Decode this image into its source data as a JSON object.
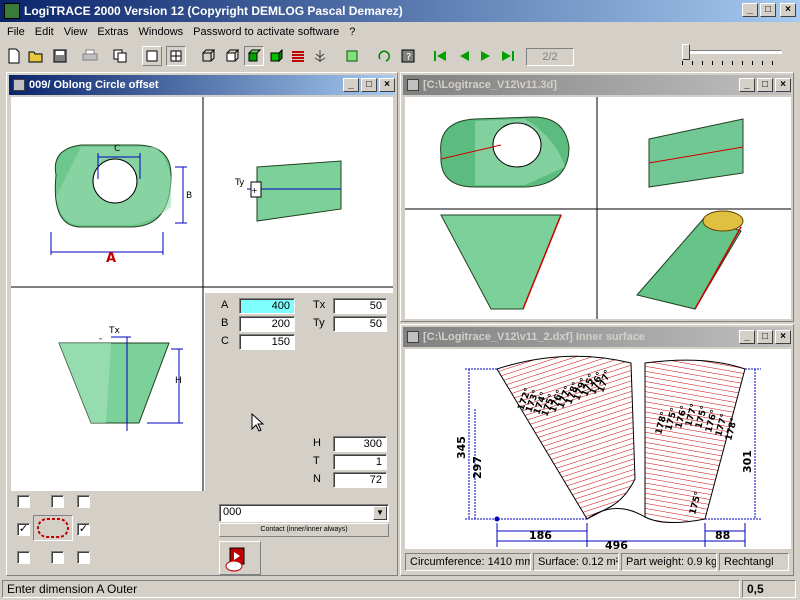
{
  "app": {
    "title": "LogiTRACE 2000  Version 12  (Copyright DEMLOG Pascal Demarez)"
  },
  "menu": [
    "File",
    "Edit",
    "View",
    "Extras",
    "Windows",
    "Password to activate software",
    "?"
  ],
  "toolbar": {
    "page_indicator": "2/2"
  },
  "window_left": {
    "title": "009/ Oblong Circle offset",
    "views": {
      "top_labels": {
        "c": "C",
        "b": "B",
        "a": "A"
      },
      "side_labels": {
        "ty": "Ty"
      },
      "front_labels": {
        "tx": "Tx",
        "h": "H",
        "minus": "-"
      }
    },
    "params": {
      "A": {
        "label": "A",
        "value": "400"
      },
      "B": {
        "label": "B",
        "value": "200"
      },
      "C": {
        "label": "C",
        "value": "150"
      },
      "Tx": {
        "label": "Tx",
        "value": "50"
      },
      "Ty": {
        "label": "Ty",
        "value": "50"
      },
      "H": {
        "label": "H",
        "value": "300"
      },
      "T": {
        "label": "T",
        "value": "1"
      },
      "N": {
        "label": "N",
        "value": "72"
      }
    },
    "combo_value": "000",
    "contact_button": "Contact (inner/inner always)"
  },
  "window_3d": {
    "title": "[C:\\Logitrace_V12\\v11.3d]"
  },
  "window_dxf": {
    "title": "[C:\\Logitrace_V12\\v11_2.dxf]  Inner surface",
    "dims": {
      "d345": "345",
      "d297": "297",
      "d301": "301",
      "d186": "186",
      "d88": "88",
      "d496": "496"
    },
    "angles_left": [
      "172°",
      "173°",
      "174°",
      "175°",
      "176°",
      "177°",
      "178°",
      "179°",
      "175°",
      "176°",
      "177°"
    ],
    "angles_right": [
      "178°",
      "175°",
      "176°",
      "177°",
      "175°",
      "176°",
      "177°",
      "178°"
    ],
    "angle_bottom": "175°",
    "status": {
      "circumference": "Circumference: 1410 mm",
      "surface": "Surface: 0.12 m²",
      "weight": "Part weight: 0.9 kg",
      "mode": "Rechtangl"
    }
  },
  "statusbar": {
    "message": "Enter dimension A Outer",
    "value": "0,5"
  },
  "colors": {
    "title_active": "#0a246a",
    "title_inactive": "#808080",
    "surface_green": "#8fd4a8",
    "dim_blue": "#0000c0",
    "accent_red": "#d00000",
    "field_highlight": "#80ffff"
  }
}
